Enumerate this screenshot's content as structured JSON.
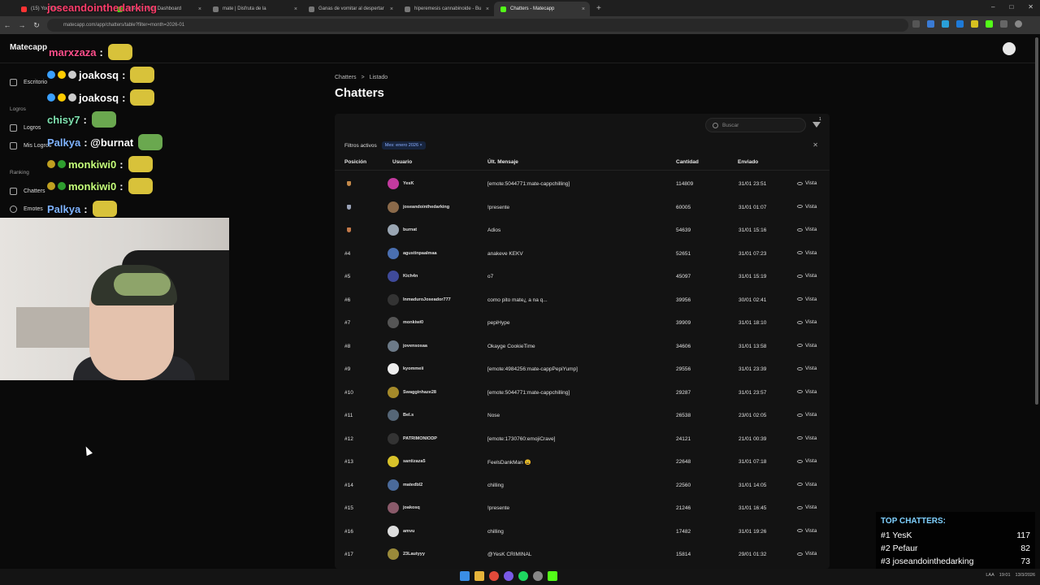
{
  "browser": {
    "tabs": [
      {
        "label": "(15) YouTube",
        "color": "#ff3333",
        "active": false
      },
      {
        "label": "Stream - Kick Dashboard",
        "color": "#53fc18",
        "active": false
      },
      {
        "label": "mate | Disfruta de la",
        "color": "#777777",
        "active": false
      },
      {
        "label": "Ganas de vomitar al despertar",
        "color": "#777777",
        "active": false
      },
      {
        "label": "hiperemesis cannabinoide - Bu",
        "color": "#777777",
        "active": false
      },
      {
        "label": "Chatters - Matecapp",
        "color": "#53fc18",
        "active": true
      }
    ],
    "new_tab": "+",
    "url": "matecapp.com/app/chatters/table?filter=month=2026-01",
    "controls": {
      "minimize": "–",
      "maximize": "□",
      "close": "✕"
    }
  },
  "app": {
    "brand": "Matecapp",
    "sidebar": {
      "items": [
        {
          "label": "Escritorio",
          "section": ""
        },
        {
          "label": "Logros",
          "section": "Logros"
        },
        {
          "label": "Mis Logros",
          "section": ""
        },
        {
          "label": "Chatters",
          "section": "Ranking"
        },
        {
          "label": "Emotes",
          "section": ""
        }
      ],
      "sections": [
        "Logros",
        "Ranking"
      ]
    },
    "breadcrumb": [
      "Chatters",
      "Listado"
    ],
    "breadcrumb_sep": ">",
    "title": "Chatters",
    "search_placeholder": "Buscar",
    "filter_count": "1",
    "filters_label": "Filtros activos",
    "filter_chip": "Mes: enero 2026  ×",
    "columns": {
      "position": "Posición",
      "user": "Usuario",
      "last_message": "Últ. Mensaje",
      "count": "Cantidad",
      "sent": "Enviado"
    },
    "view_label": "Vista",
    "rows": [
      {
        "pos": "",
        "medal": "#c48a4a",
        "avatar": "#c23a9e",
        "user": "YesK",
        "msg": "[emote:5044771:mate-cappchilling]",
        "qty": "114809",
        "sent": "31/01 23:51"
      },
      {
        "pos": "",
        "medal": "#9aa3b8",
        "avatar": "#8b6a4a",
        "user": "joseandointhedarking",
        "msg": "!presente",
        "qty": "60005",
        "sent": "31/01 01:07"
      },
      {
        "pos": "",
        "medal": "#c47a4a",
        "avatar": "#9aa6b3",
        "user": "burnat",
        "msg": "Adios",
        "qty": "54639",
        "sent": "31/01 15:16"
      },
      {
        "pos": "#4",
        "medal": "",
        "avatar": "#4a6fb0",
        "user": "agustinpaalmaa",
        "msg": "anakeve KEKV",
        "qty": "52651",
        "sent": "31/01 07:23"
      },
      {
        "pos": "#5",
        "medal": "",
        "avatar": "#3f4a9a",
        "user": "Kich4n",
        "msg": "o7",
        "qty": "45097",
        "sent": "31/01 15:19"
      },
      {
        "pos": "#6",
        "medal": "",
        "avatar": "#333333",
        "user": "InmaduroJoseador777",
        "msg": "como pito mate¿ a na q...",
        "qty": "39956",
        "sent": "30/01 02:41"
      },
      {
        "pos": "#7",
        "medal": "",
        "avatar": "#555555",
        "user": "monkiwi0",
        "msg": "pepiHype",
        "qty": "39909",
        "sent": "31/01 18:10"
      },
      {
        "pos": "#8",
        "medal": "",
        "avatar": "#6c7a88",
        "user": "jovensosaa",
        "msg": "Okayge CookieTime",
        "qty": "34606",
        "sent": "31/01 13:58"
      },
      {
        "pos": "#9",
        "medal": "",
        "avatar": "#eeeeee",
        "user": "kyommeii",
        "msg": "[emote:4984256:mate-cappPepiYump]",
        "qty": "29556",
        "sent": "31/01 23:39"
      },
      {
        "pos": "#10",
        "medal": "",
        "avatar": "#a58a2a",
        "user": "Swagginhaze28",
        "msg": "[emote:5044771:mate-cappchilling]",
        "qty": "29287",
        "sent": "31/01 23:57"
      },
      {
        "pos": "#11",
        "medal": "",
        "avatar": "#556677",
        "user": "Bel.s",
        "msg": "Nose",
        "qty": "26538",
        "sent": "23/01 02:05"
      },
      {
        "pos": "#12",
        "medal": "",
        "avatar": "#333333",
        "user": "PATRIMONIODP",
        "msg": "[emote:1730760:emojiCrave]",
        "qty": "24121",
        "sent": "21/01 00:39"
      },
      {
        "pos": "#13",
        "medal": "",
        "avatar": "#d8c22a",
        "user": "santizaza5",
        "msg": "FeelsDankMan 😩",
        "qty": "22648",
        "sent": "31/01 07:18"
      },
      {
        "pos": "#14",
        "medal": "",
        "avatar": "#4a6a9a",
        "user": "matedbl2",
        "msg": "chilling",
        "qty": "22560",
        "sent": "31/01 14:05"
      },
      {
        "pos": "#15",
        "medal": "",
        "avatar": "#8a5a6a",
        "user": "joakosq",
        "msg": "!presente",
        "qty": "21246",
        "sent": "31/01 16:45"
      },
      {
        "pos": "#16",
        "medal": "",
        "avatar": "#dddddd",
        "user": "amvu",
        "msg": "chilling",
        "qty": "17482",
        "sent": "31/01 19:26"
      },
      {
        "pos": "#17",
        "medal": "",
        "avatar": "#9a8a3a",
        "user": "23Lautyyy",
        "msg": "@YesK CRIMINAL",
        "qty": "15814",
        "sent": "29/01 01:32"
      }
    ]
  },
  "chat_overlay": [
    {
      "user": "joseandointhedarking",
      "text": "",
      "color": "#ff3d6b",
      "badges": []
    },
    {
      "user": "marxzaza",
      "text": ":",
      "color": "#ff4f8b",
      "badges": []
    },
    {
      "user": "joakosq",
      "text": ":",
      "color": "#ffffff",
      "badges": [
        "#3aa0ff",
        "#ffcc00",
        "#cccccc"
      ]
    },
    {
      "user": "joakosq",
      "text": ":",
      "color": "#ffffff",
      "badges": [
        "#3aa0ff",
        "#ffcc00",
        "#cccccc"
      ]
    },
    {
      "user": "chisy7",
      "text": ":",
      "color": "#7fe3b0",
      "badges": []
    },
    {
      "user": "Palkya",
      "text": ": @burnat",
      "color": "#7fb3ff",
      "badges": []
    },
    {
      "user": "monkiwi0",
      "text": ":",
      "color": "#c5ff7a",
      "badges": [
        "#c0a020",
        "#2e9e2e"
      ]
    },
    {
      "user": "monkiwi0",
      "text": ":",
      "color": "#c5ff7a",
      "badges": [
        "#c0a020",
        "#2e9e2e"
      ]
    },
    {
      "user": "Palkya",
      "text": ":",
      "color": "#7fb3ff",
      "badges": []
    }
  ],
  "top_chatters": {
    "title": "TOP CHATTERS:",
    "entries": [
      {
        "rank": "#1",
        "name": "YesK",
        "count": "117"
      },
      {
        "rank": "#2",
        "name": "Pefaur",
        "count": "82"
      },
      {
        "rank": "#3",
        "name": "joseandointhedarking",
        "count": "73"
      }
    ]
  },
  "taskbar": {
    "tray_lang": "LAA",
    "tray_time": "19:01",
    "tray_date": "13/3/2026"
  }
}
